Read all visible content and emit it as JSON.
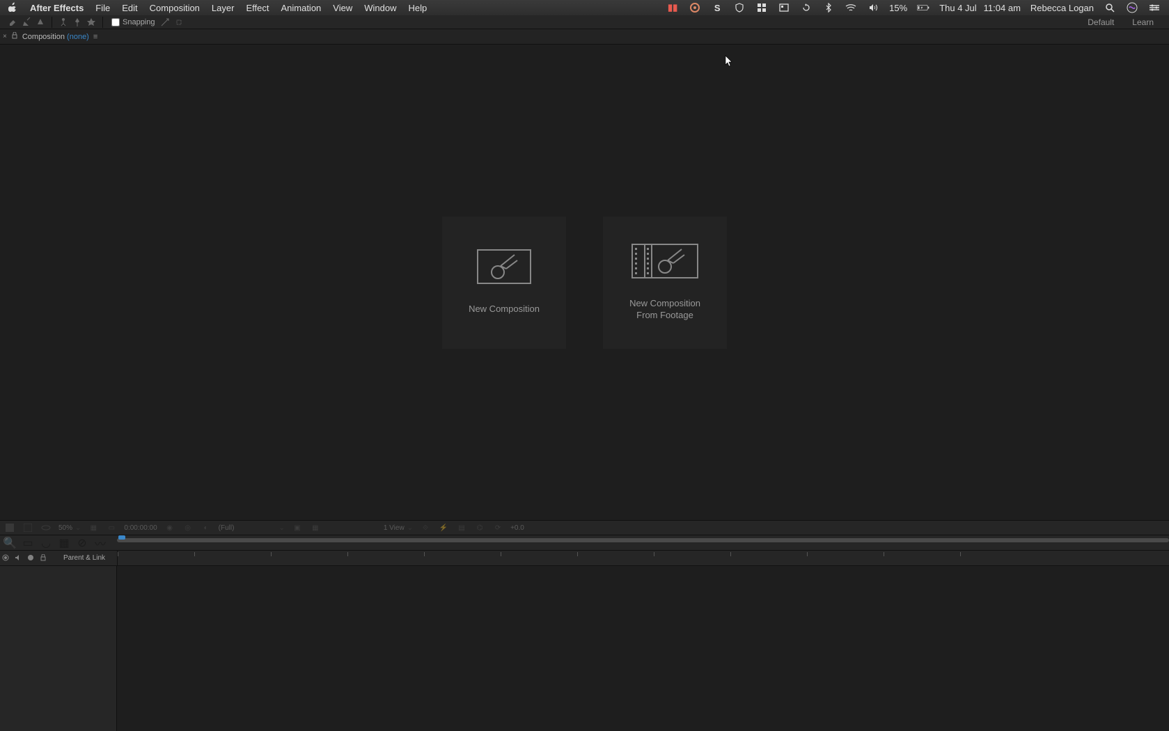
{
  "menubar": {
    "apple": "",
    "app_name": "After Effects",
    "items": [
      "File",
      "Edit",
      "Composition",
      "Layer",
      "Effect",
      "Animation",
      "View",
      "Window",
      "Help"
    ],
    "battery": "15%",
    "date": "Thu 4 Jul",
    "time": "11:04 am",
    "user": "Rebecca Logan"
  },
  "toolbar": {
    "snapping_label": "Snapping",
    "workspaces": [
      "Default",
      "Learn"
    ]
  },
  "panel": {
    "title_prefix": "Composition",
    "title_none": "(none)"
  },
  "cards": {
    "new_comp": "New Composition",
    "new_comp_footage_l1": "New Composition",
    "new_comp_footage_l2": "From Footage"
  },
  "viewer_footer": {
    "zoom": "50%",
    "timecode": "0:00:00:00",
    "resolution": "(Full)",
    "views": "1 View",
    "exposure": "+0.0"
  },
  "timeline": {
    "parent_link": "Parent & Link"
  }
}
